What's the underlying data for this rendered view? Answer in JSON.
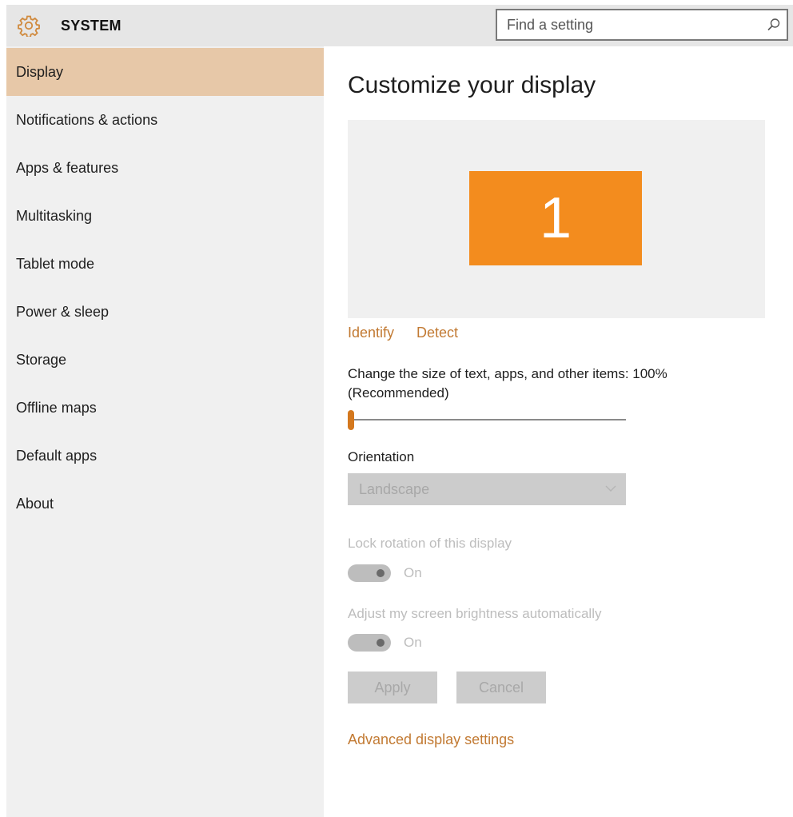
{
  "header": {
    "title": "SYSTEM",
    "search_placeholder": "Find a setting",
    "search_value": ""
  },
  "icons": {
    "app": "gear-icon",
    "search": "search-icon",
    "dropdown": "chevron-down-icon"
  },
  "colors": {
    "accent": "#c27a33",
    "selected_nav": "#e7c8a8",
    "monitor": "#f38c1e"
  },
  "sidebar": {
    "items": [
      {
        "label": "Display",
        "selected": true
      },
      {
        "label": "Notifications & actions"
      },
      {
        "label": "Apps & features"
      },
      {
        "label": "Multitasking"
      },
      {
        "label": "Tablet mode"
      },
      {
        "label": "Power & sleep"
      },
      {
        "label": "Storage"
      },
      {
        "label": "Offline maps"
      },
      {
        "label": "Default apps"
      },
      {
        "label": "About"
      }
    ]
  },
  "main": {
    "title": "Customize your display",
    "monitor_number": "1",
    "identify_link": "Identify",
    "detect_link": "Detect",
    "scale_label_line1": "Change the size of text, apps, and other items: 100%",
    "scale_label_line2": "(Recommended)",
    "scale_slider_fraction": 0,
    "orientation_label": "Orientation",
    "orientation_value": "Landscape",
    "lock_rotation_label": "Lock rotation of this display",
    "lock_rotation_state": "On",
    "brightness_label": "Adjust my screen brightness automatically",
    "brightness_state": "On",
    "apply_button": "Apply",
    "cancel_button": "Cancel",
    "advanced_link": "Advanced display settings"
  }
}
